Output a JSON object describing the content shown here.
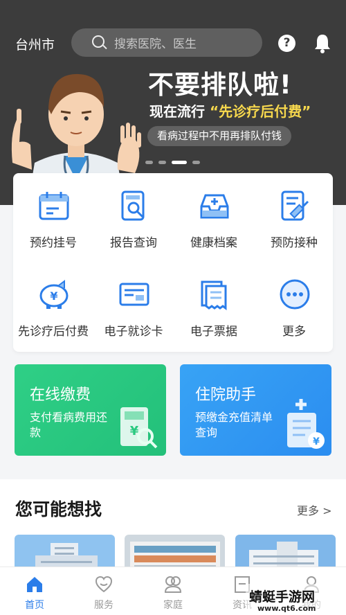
{
  "header": {
    "city": "台州市",
    "search_placeholder": "搜索医院、医生"
  },
  "banner": {
    "headline": "不要排队啦!",
    "sub_prefix": "现在流行",
    "sub_highlight": "“先诊疗后付费”",
    "pill": "看病过程中不用再排队付钱",
    "slides": 4,
    "active_slide": 3
  },
  "grid": [
    {
      "label": "预约挂号",
      "icon": "calendar-icon"
    },
    {
      "label": "报告查询",
      "icon": "report-search-icon"
    },
    {
      "label": "健康档案",
      "icon": "archive-box-icon"
    },
    {
      "label": "预防接种",
      "icon": "vaccine-icon"
    },
    {
      "label": "先诊疗后付费",
      "icon": "piggy-bank-icon"
    },
    {
      "label": "电子就诊卡",
      "icon": "card-icon"
    },
    {
      "label": "电子票据",
      "icon": "receipt-icon"
    },
    {
      "label": "更多",
      "icon": "more-dots-icon"
    }
  ],
  "promos": [
    {
      "title": "在线缴费",
      "desc": "支付看病费用还款",
      "color": "#2bc980"
    },
    {
      "title": "住院助手",
      "desc": "预缴金充值清单查询",
      "color": "#3399f3"
    }
  ],
  "section": {
    "title": "您可能想找",
    "more": "更多 >"
  },
  "tabs": [
    {
      "label": "首页",
      "icon": "home-icon",
      "active": true
    },
    {
      "label": "服务",
      "icon": "heart-hand-icon",
      "active": false
    },
    {
      "label": "家庭",
      "icon": "family-icon",
      "active": false
    },
    {
      "label": "资讯",
      "icon": "news-icon",
      "active": false
    },
    {
      "label": "我的",
      "icon": "user-icon",
      "active": false
    }
  ],
  "watermark": {
    "text": "蜻蜓手游网",
    "url": "www.qt6.com"
  },
  "colors": {
    "primary": "#2b7de9",
    "banner_bg": "#3c3c3c",
    "highlight": "#f7d84d"
  }
}
